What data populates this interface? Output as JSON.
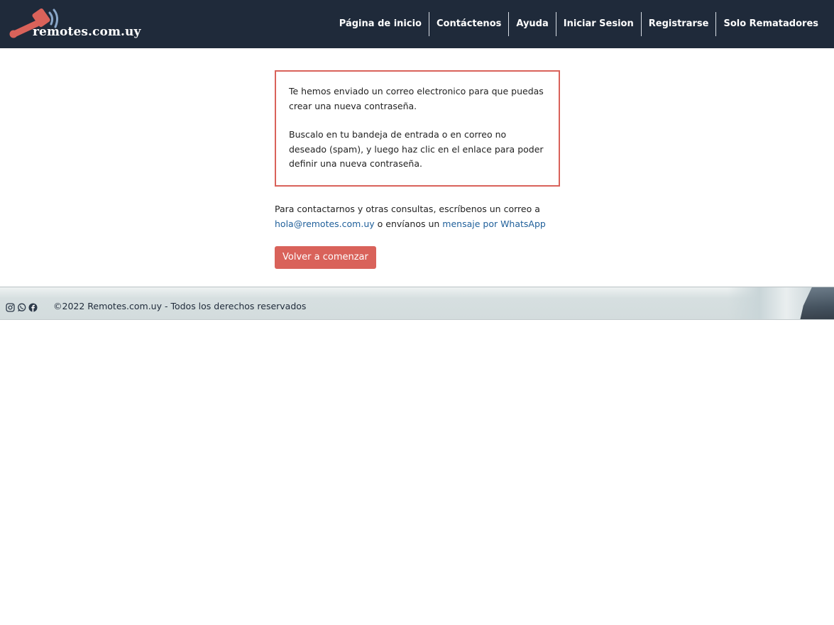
{
  "brand": {
    "name": "remotes.com.uy",
    "colors": {
      "navbar": "#1f2a3a",
      "accent": "#d9625a",
      "link": "#1f5f9a",
      "logo_waves": "#8aa6c8"
    }
  },
  "nav": {
    "items": [
      {
        "label": "Página de inicio"
      },
      {
        "label": "Contáctenos"
      },
      {
        "label": "Ayuda"
      },
      {
        "label": "Iniciar Sesion"
      },
      {
        "label": "Registrarse"
      },
      {
        "label": "Solo Rematadores"
      }
    ]
  },
  "notice": {
    "paragraph1": "Te hemos enviado un correo electronico para que puedas crear una nueva contraseña.",
    "paragraph2": "Buscalo en tu bandeja de entrada o en correo no deseado (spam), y luego haz clic en el enlace para poder definir una nueva contraseña."
  },
  "contact": {
    "text_before": "Para contactarnos y otras consultas, escríbenos un correo a ",
    "email_link": "hola@remotes.com.uy",
    "text_middle": " o envíanos un ",
    "whatsapp_link": "mensaje por WhatsApp"
  },
  "actions": {
    "restart_label": "Volver a comenzar"
  },
  "footer": {
    "icons": [
      "instagram-icon",
      "whatsapp-icon",
      "facebook-icon"
    ],
    "copyright": "©2022 Remotes.com.uy - Todos los derechos reservados"
  }
}
